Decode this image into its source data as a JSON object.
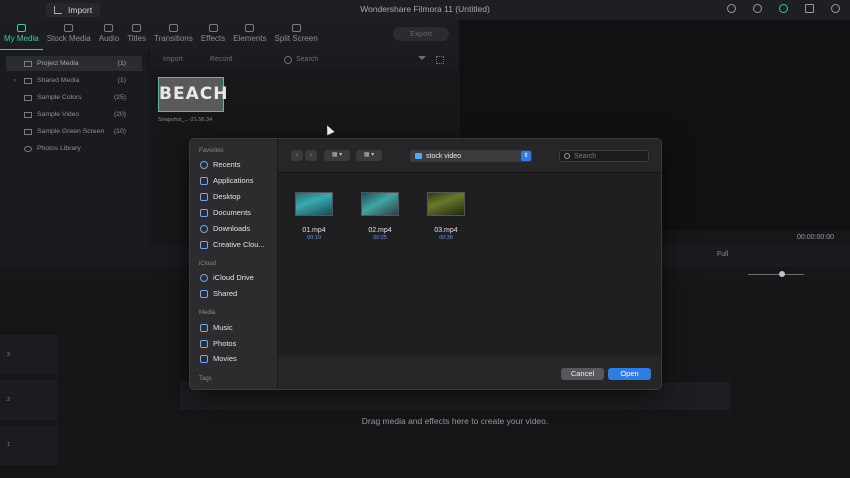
{
  "app": {
    "title": "Wondershare Filmora 11 (Untitled)",
    "import_label": "Import",
    "export_label": "Export"
  },
  "tabs": [
    {
      "label": "My Media",
      "icon": "folder-icon",
      "active": true
    },
    {
      "label": "Stock Media",
      "icon": "stock-icon",
      "active": false
    },
    {
      "label": "Audio",
      "icon": "music-icon",
      "active": false
    },
    {
      "label": "Titles",
      "icon": "title-icon",
      "active": false
    },
    {
      "label": "Transitions",
      "icon": "transition-icon",
      "active": false
    },
    {
      "label": "Effects",
      "icon": "effects-icon",
      "active": false
    },
    {
      "label": "Elements",
      "icon": "elements-icon",
      "active": false
    },
    {
      "label": "Split Screen",
      "icon": "split-screen-icon",
      "active": false
    }
  ],
  "media_toolbar": {
    "import": "Import",
    "record": "Record",
    "search_placeholder": "Search"
  },
  "library": [
    {
      "label": "Project Media",
      "count": "(1)",
      "active": true
    },
    {
      "label": "Shared Media",
      "count": "(1)",
      "active": false
    },
    {
      "label": "Sample Colors",
      "count": "(25)",
      "active": false
    },
    {
      "label": "Sample Video",
      "count": "(20)",
      "active": false
    },
    {
      "label": "Sample Green Screen",
      "count": "(10)",
      "active": false
    },
    {
      "label": "Photos Library",
      "count": "",
      "active": false
    }
  ],
  "media_item": {
    "thumb_text": "BEACH",
    "caption": "Snapshot_...-21.56.34"
  },
  "preview": {
    "timecode": "00:00:00:00",
    "quality": "Full"
  },
  "timeline": {
    "drop_hint": "Drag media and effects here to create your video.",
    "tracks": [
      "3",
      "2",
      "1"
    ]
  },
  "dialog": {
    "sections": {
      "favorites": "Favorites",
      "icloud": "iCloud",
      "media": "Media",
      "tags": "Tags"
    },
    "favorites": [
      "Recents",
      "Applications",
      "Desktop",
      "Documents",
      "Downloads",
      "Creative Clou..."
    ],
    "icloud": [
      "iCloud Drive",
      "Shared"
    ],
    "media": [
      "Music",
      "Photos",
      "Movies"
    ],
    "path": "stock video",
    "search_placeholder": "Search",
    "files": [
      {
        "name": "01.mp4",
        "duration": "00:10"
      },
      {
        "name": "02.mp4",
        "duration": "00:25"
      },
      {
        "name": "03.mp4",
        "duration": "00:36"
      }
    ],
    "cancel_label": "Cancel",
    "open_label": "Open",
    "accent_color": "#2f7de1"
  }
}
